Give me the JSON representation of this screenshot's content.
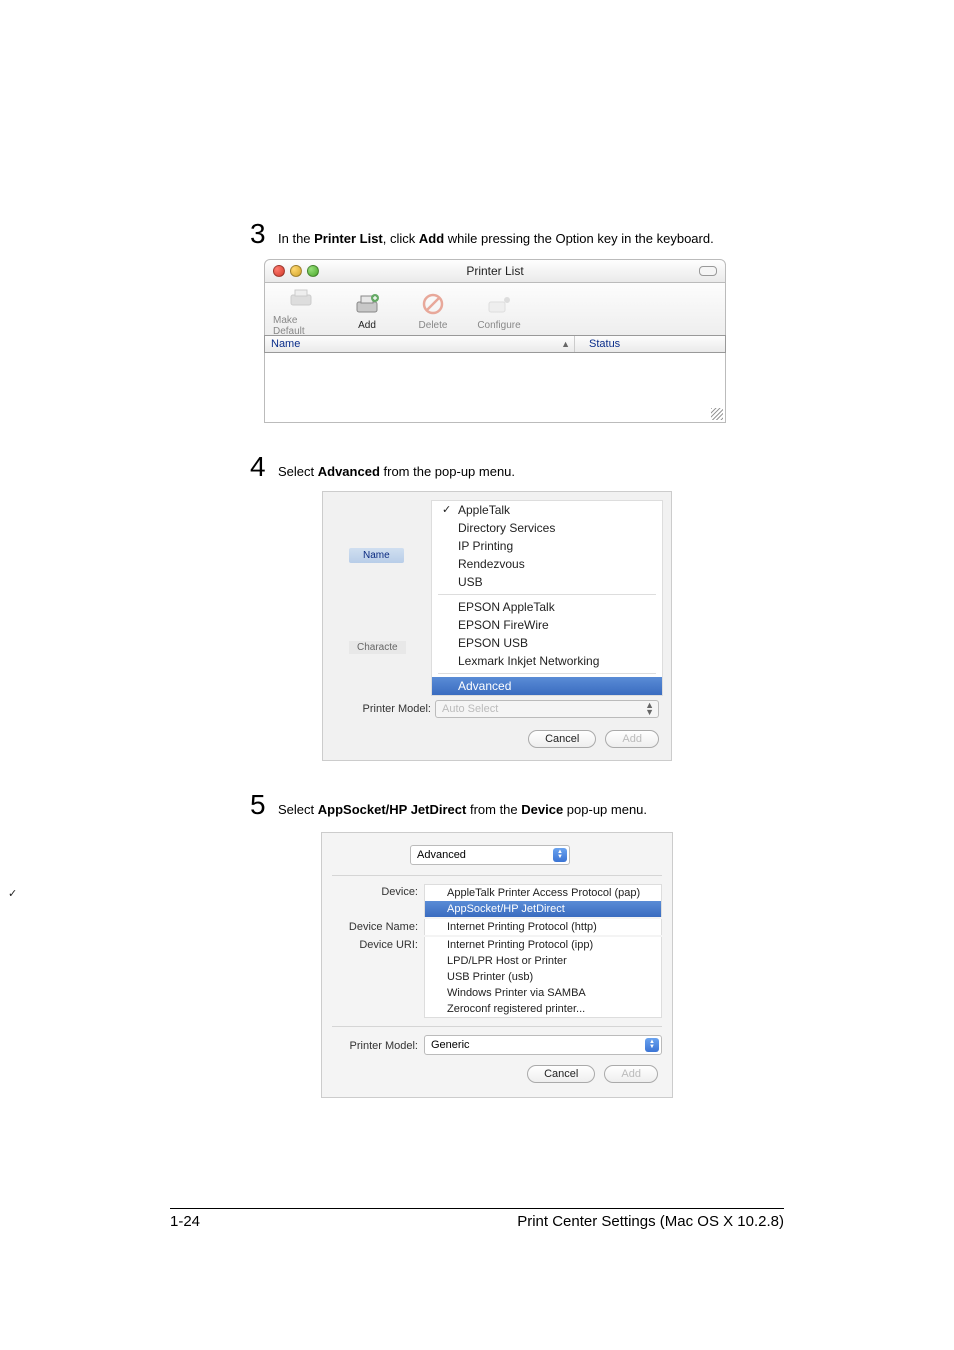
{
  "steps": {
    "s3": {
      "num": "3",
      "text_a": "In the ",
      "bold_a": "Printer List",
      "text_b": ", click ",
      "bold_b": "Add",
      "text_c": " while pressing the Option key in the keyboard."
    },
    "s4": {
      "num": "4",
      "text_a": "Select ",
      "bold_a": "Advanced",
      "text_b": " from the pop-up menu."
    },
    "s5": {
      "num": "5",
      "text_a": "Select ",
      "bold_a": "AppSocket/HP JetDirect",
      "text_b": " from the ",
      "bold_b": "Device",
      "text_c": " pop-up menu."
    }
  },
  "win1": {
    "title": "Printer List",
    "toolbar": {
      "make_default": "Make Default",
      "add": "Add",
      "delete": "Delete",
      "configure": "Configure"
    },
    "columns": {
      "name": "Name",
      "status": "Status"
    }
  },
  "win2": {
    "left": {
      "name": "Name",
      "character": "Characte",
      "printer_model": "Printer Model:"
    },
    "options": {
      "appletalk": "AppleTalk",
      "directory": "Directory Services",
      "ip": "IP Printing",
      "rendezvous": "Rendezvous",
      "usb": "USB",
      "epson_at": "EPSON AppleTalk",
      "epson_fw": "EPSON FireWire",
      "epson_usb": "EPSON USB",
      "lexmark": "Lexmark Inkjet Networking",
      "advanced": "Advanced"
    },
    "auto_select": "Auto Select",
    "cancel": "Cancel",
    "add": "Add"
  },
  "win3": {
    "top_select": "Advanced",
    "labels": {
      "device": "Device:",
      "device_name": "Device Name:",
      "device_uri": "Device URI:",
      "printer_model": "Printer Model:"
    },
    "options": {
      "appletalk_pap": "AppleTalk Printer Access Protocol (pap)",
      "appsocket": "AppSocket/HP JetDirect",
      "ipp_http": "Internet Printing Protocol (http)",
      "ipp_ipp": "Internet Printing Protocol (ipp)",
      "lpd": "LPD/LPR Host or Printer",
      "usb_printer": "USB Printer (usb)",
      "samba": "Windows Printer via SAMBA",
      "zeroconf": "Zeroconf registered printer..."
    },
    "generic": "Generic",
    "cancel": "Cancel",
    "add": "Add"
  },
  "footer": {
    "page": "1-24",
    "title": "Print Center Settings (Mac OS X 10.2.8)"
  }
}
